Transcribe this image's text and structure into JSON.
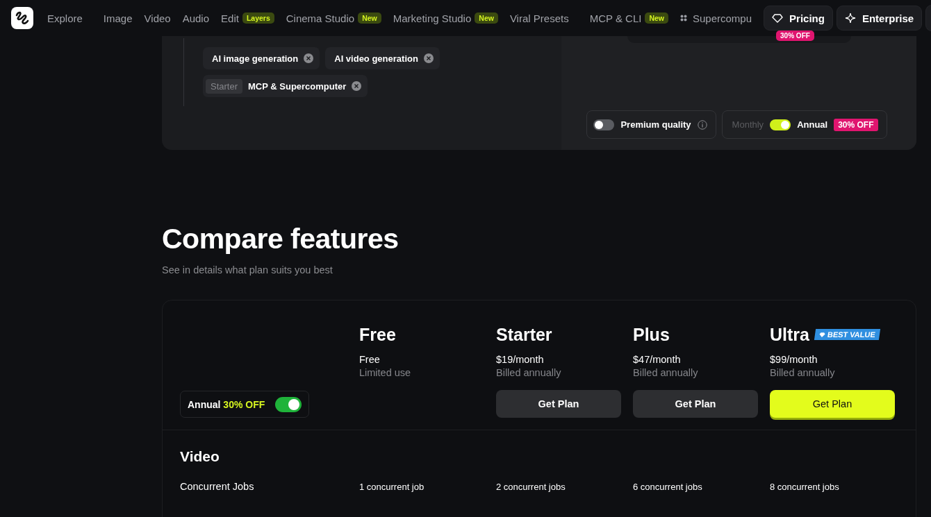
{
  "nav": {
    "groups": [
      [
        {
          "label": "Explore"
        }
      ],
      [
        {
          "label": "Image"
        },
        {
          "label": "Video"
        },
        {
          "label": "Audio"
        },
        {
          "label": "Edit",
          "badge": "Layers"
        },
        {
          "label": "Cinema Studio",
          "badge": "New"
        },
        {
          "label": "Marketing Studio",
          "badge": "New"
        },
        {
          "label": "Viral Presets"
        }
      ],
      [
        {
          "label": "MCP & CLI",
          "badge": "New"
        },
        {
          "label": "Supercompu",
          "kind": "grid"
        }
      ]
    ],
    "pricing": {
      "label": "Pricing",
      "badge": "30% OFF"
    },
    "enterprise": {
      "label": "Enterprise"
    }
  },
  "filters": {
    "chips": [
      {
        "label": "AI image generation"
      },
      {
        "label": "AI video generation"
      },
      {
        "prefix": "Starter",
        "label": "MCP & Supercomputer"
      }
    ],
    "premium": {
      "label": "Premium quality",
      "on": false
    },
    "billing": {
      "monthly": "Monthly",
      "annual": "Annual",
      "on": true,
      "discount": "30% OFF"
    }
  },
  "compare": {
    "title": "Compare features",
    "subtitle": "See in details what plan suits you best",
    "annual_toggle": {
      "label": "Annual",
      "discount": "30% OFF",
      "on": true
    },
    "plans": [
      {
        "name": "Free",
        "price": "Free",
        "note": "Limited use"
      },
      {
        "name": "Starter",
        "price": "$19/month",
        "note": "Billed annually",
        "button": "Get Plan",
        "primary": false
      },
      {
        "name": "Plus",
        "price": "$47/month",
        "note": "Billed annually",
        "button": "Get Plan",
        "primary": false
      },
      {
        "name": "Ultra",
        "badge": "BEST VALUE",
        "price": "$99/month",
        "note": "Billed annually",
        "button": "Get Plan",
        "primary": true
      }
    ],
    "sections": [
      {
        "title": "Video",
        "rows": [
          {
            "label": "Concurrent Jobs",
            "values": [
              "1 concurrent job",
              "2 concurrent jobs",
              "6 concurrent jobs",
              "8 concurrent jobs"
            ]
          }
        ]
      }
    ]
  }
}
